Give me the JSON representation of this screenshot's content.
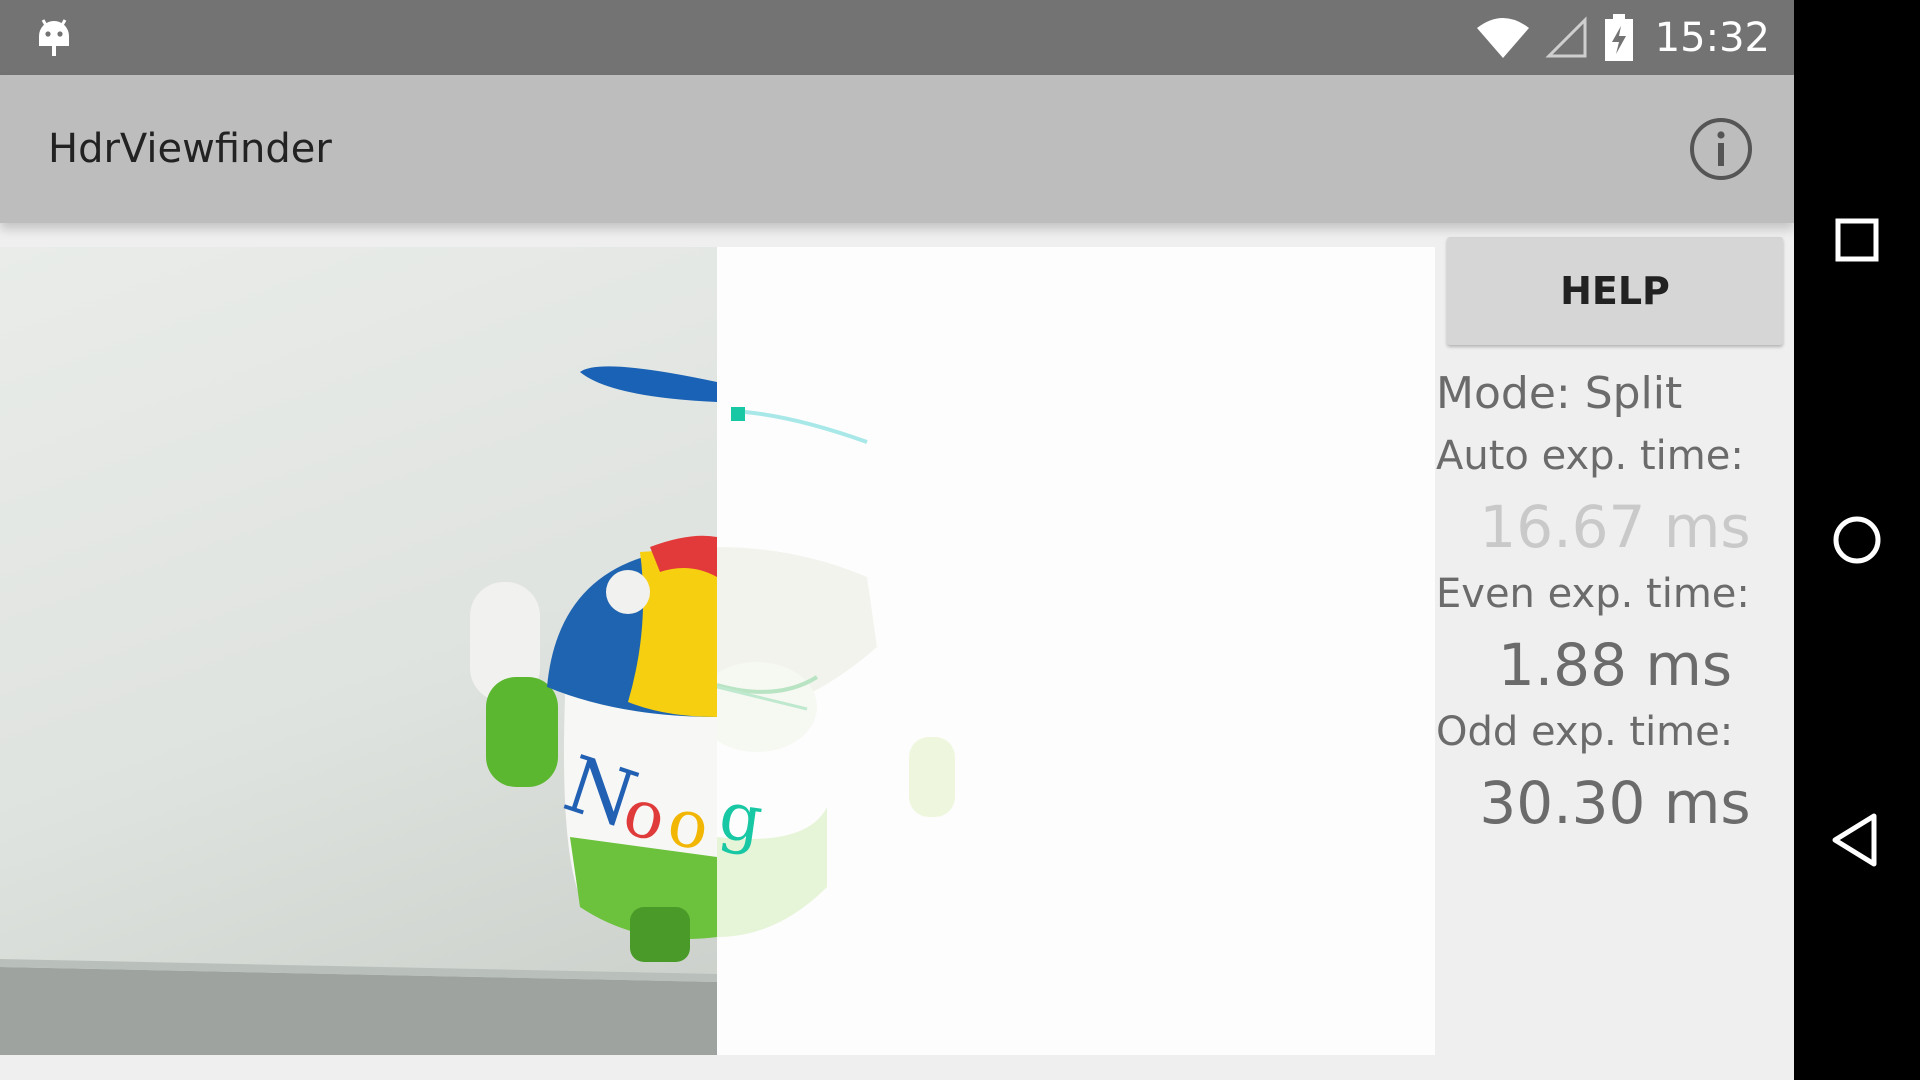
{
  "status_bar": {
    "time": "15:32",
    "icons": [
      "android-debug-icon",
      "wifi-icon",
      "cell-signal-icon",
      "battery-charging-icon"
    ]
  },
  "app_bar": {
    "title": "HdrViewfinder",
    "info_icon": "info-icon"
  },
  "viewfinder": {
    "mode_split": true,
    "label_text": "Noog"
  },
  "side_panel": {
    "help_label": "HELP",
    "mode_label": "Mode: Split",
    "auto_exp_label": "Auto exp. time:",
    "auto_exp_value": "16.67 ms",
    "even_exp_label": "Even exp. time:",
    "even_exp_value": "1.88 ms",
    "odd_exp_label": "Odd exp. time:",
    "odd_exp_value": "30.30 ms"
  },
  "nav_bar": {
    "icons": [
      "recents-icon",
      "home-icon",
      "back-icon"
    ]
  },
  "colors": {
    "status_bar": "#737373",
    "app_bar": "#bdbdbd",
    "background": "#efefef",
    "nav_bar": "#000000",
    "text_gray": "#6b6b6b",
    "text_dim": "#c9c9c9"
  }
}
